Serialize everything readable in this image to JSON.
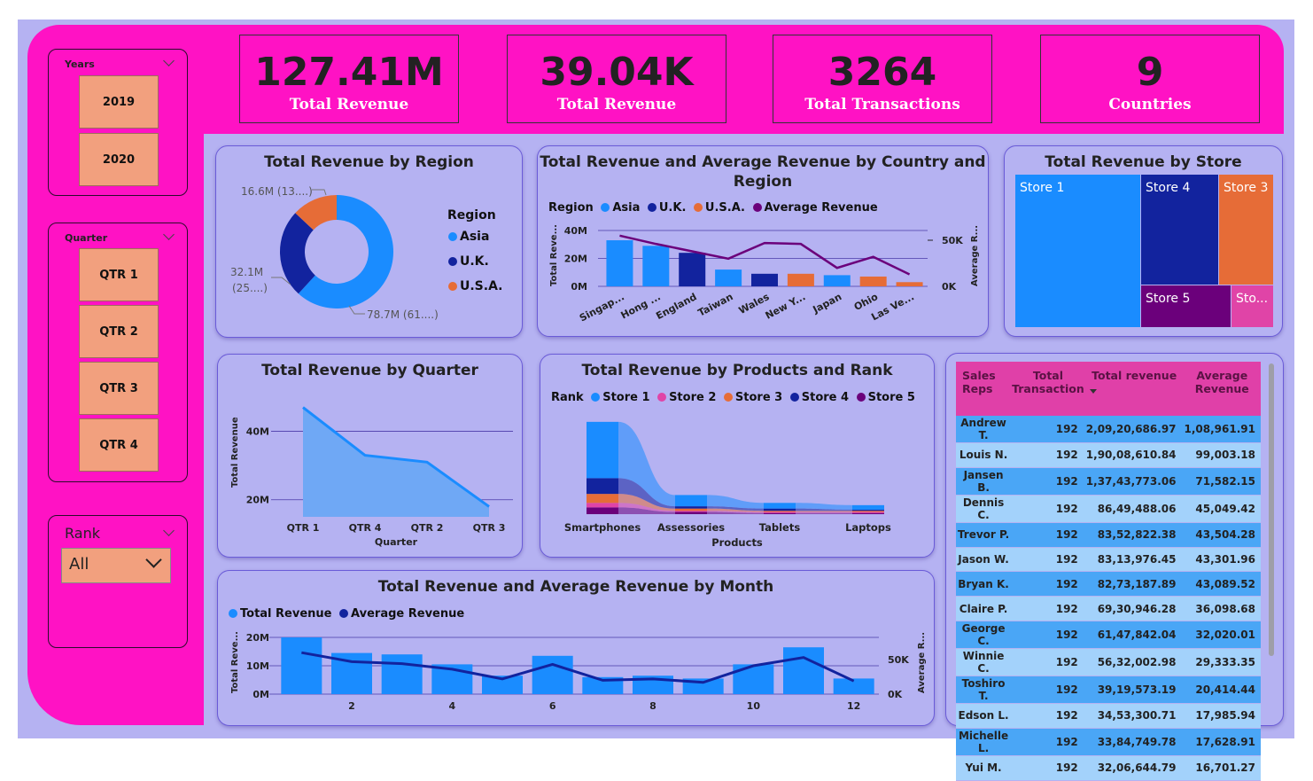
{
  "slicers": {
    "years": {
      "title": "Years",
      "items": [
        "2019",
        "2020"
      ]
    },
    "quarter": {
      "title": "Quarter",
      "items": [
        "QTR 1",
        "QTR 2",
        "QTR 3",
        "QTR 4"
      ]
    },
    "rank": {
      "title": "Rank",
      "selected": "All"
    }
  },
  "kpis": [
    {
      "value": "127.41M",
      "label": "Total Revenue"
    },
    {
      "value": "39.04K",
      "label": "Total Revenue"
    },
    {
      "value": "3264",
      "label": "Total Transactions"
    },
    {
      "value": "9",
      "label": "Countries"
    }
  ],
  "colors": {
    "asia": "#1a8cff",
    "uk": "#12239e",
    "usa": "#e66c37",
    "average": "#6b007b",
    "store2": "#e044a7",
    "store5": "#744ec2"
  },
  "region_chart": {
    "title": "Total Revenue by Region",
    "legend_title": "Region",
    "legend": [
      "Asia",
      "U.K.",
      "U.S.A."
    ],
    "labels": {
      "usa": "16.6M (13....)",
      "uk_line1": "32.1M",
      "uk_line2": "(25....)",
      "asia": "78.7M (61....)"
    }
  },
  "country_chart": {
    "title_line1": "Total Revenue and Average Revenue by Country and",
    "title_line2": "Region",
    "legend_label": "Region",
    "legend": [
      "Asia",
      "U.K.",
      "U.S.A.",
      "Average Revenue"
    ],
    "y_ticks": [
      "40M",
      "20M",
      "0M"
    ],
    "y2_ticks": [
      "50K",
      "0K"
    ],
    "y_axis": "Total Reve...",
    "y2_axis": "Average R...",
    "countries": [
      "Singap...",
      "Hong ...",
      "England",
      "Taiwan",
      "Wales",
      "New Y...",
      "Japan",
      "Ohio",
      "Las Ve..."
    ]
  },
  "store_chart": {
    "title": "Total Revenue by Store",
    "stores": [
      "Store 1",
      "Store 4",
      "Store 3",
      "Store 5",
      "Sto..."
    ]
  },
  "quarter_chart": {
    "title": "Total Revenue by Quarter",
    "y_axis": "Total Revenue",
    "x_axis": "Quarter",
    "y_ticks": [
      "40M",
      "20M"
    ],
    "categories": [
      "QTR 1",
      "QTR 4",
      "QTR 2",
      "QTR 3"
    ]
  },
  "products_chart": {
    "title": "Total Revenue by Products and Rank",
    "legend_label": "Rank",
    "legend": [
      "Store 1",
      "Store 2",
      "Store 3",
      "Store 4",
      "Store 5"
    ],
    "categories": [
      "Smartphones",
      "Assessories",
      "Tablets",
      "Laptops"
    ],
    "x_axis": "Products"
  },
  "month_chart": {
    "title": "Total Revenue and Average Revenue by Month",
    "legend": [
      "Total Revenue",
      "Average Revenue"
    ],
    "y_ticks": [
      "20M",
      "10M",
      "0M"
    ],
    "y2_ticks": [
      "50K",
      "0K"
    ],
    "y_axis": "Total Reve...",
    "y2_axis": "Average R...",
    "x_ticks": [
      "2",
      "4",
      "6",
      "8",
      "10",
      "12"
    ]
  },
  "sales_table": {
    "headers": [
      "Sales Reps",
      "Total Transaction",
      "Total revenue",
      "Average Revenue"
    ],
    "rows": [
      [
        "Andrew T.",
        "192",
        "2,09,20,686.97",
        "1,08,961.91"
      ],
      [
        "Louis N.",
        "192",
        "1,90,08,610.84",
        "99,003.18"
      ],
      [
        "Jansen B.",
        "192",
        "1,37,43,773.06",
        "71,582.15"
      ],
      [
        "Dennis C.",
        "192",
        "86,49,488.06",
        "45,049.42"
      ],
      [
        "Trevor P.",
        "192",
        "83,52,822.38",
        "43,504.28"
      ],
      [
        "Jason W.",
        "192",
        "83,13,976.45",
        "43,301.96"
      ],
      [
        "Bryan K.",
        "192",
        "82,73,187.89",
        "43,089.52"
      ],
      [
        "Claire P.",
        "192",
        "69,30,946.28",
        "36,098.68"
      ],
      [
        "George C.",
        "192",
        "61,47,842.04",
        "32,020.01"
      ],
      [
        "Winnie C.",
        "192",
        "56,32,002.98",
        "29,333.35"
      ],
      [
        "Toshiro T.",
        "192",
        "39,19,573.19",
        "20,414.44"
      ],
      [
        "Edson L.",
        "192",
        "34,53,300.71",
        "17,985.94"
      ],
      [
        "Michelle L.",
        "192",
        "33,84,749.78",
        "17,628.91"
      ],
      [
        "Yui M.",
        "192",
        "32,06,644.79",
        "16,701.27"
      ]
    ]
  },
  "chart_data": [
    {
      "type": "pie",
      "title": "Total Revenue by Region",
      "categories": [
        "Asia",
        "U.K.",
        "U.S.A."
      ],
      "values": [
        78.7,
        32.1,
        16.6
      ],
      "units": "M"
    },
    {
      "type": "bar",
      "title": "Total Revenue and Average Revenue by Country and Region",
      "categories": [
        "Singap...",
        "Hong ...",
        "England",
        "Taiwan",
        "Wales",
        "New Y...",
        "Japan",
        "Ohio",
        "Las Ve..."
      ],
      "series": [
        {
          "name": "Total Revenue",
          "values": [
            33,
            29,
            24,
            12,
            9,
            9,
            8,
            7,
            3
          ],
          "regions": [
            "Asia",
            "Asia",
            "U.K.",
            "Asia",
            "U.K.",
            "U.S.A.",
            "Asia",
            "U.S.A.",
            "U.S.A."
          ]
        },
        {
          "name": "Average Revenue",
          "values": [
            55,
            46,
            38,
            30,
            47,
            46,
            20,
            32,
            13
          ]
        }
      ],
      "ylim": [
        0,
        45
      ],
      "y2lim": [
        0,
        70
      ]
    },
    {
      "type": "area",
      "title": "Total Revenue by Quarter",
      "categories": [
        "QTR 1",
        "QTR 4",
        "QTR 2",
        "QTR 3"
      ],
      "values": [
        47,
        33,
        31,
        18
      ],
      "ylim": [
        10,
        50
      ]
    },
    {
      "type": "area",
      "title": "Total Revenue by Products and Rank",
      "categories": [
        "Smartphones",
        "Assessories",
        "Tablets",
        "Laptops"
      ],
      "series": [
        {
          "name": "Store 1",
          "values": [
            50,
            10,
            5,
            4
          ]
        },
        {
          "name": "Store 4",
          "values": [
            14,
            2,
            2,
            1
          ]
        },
        {
          "name": "Store 3",
          "values": [
            8,
            2,
            1,
            1
          ]
        },
        {
          "name": "Store 5",
          "values": [
            6,
            2,
            1,
            1
          ]
        },
        {
          "name": "Store 2",
          "values": [
            4,
            1,
            1,
            1
          ]
        }
      ]
    },
    {
      "type": "bar",
      "title": "Total Revenue and Average Revenue by Month",
      "x": [
        1,
        2,
        3,
        4,
        5,
        6,
        7,
        8,
        9,
        10,
        11,
        12
      ],
      "series": [
        {
          "name": "Total Revenue",
          "values": [
            20,
            14.5,
            14,
            10.5,
            6.5,
            13.5,
            6,
            6.5,
            5.5,
            10.5,
            16.5,
            5.5
          ]
        },
        {
          "name": "Average Revenue",
          "values": [
            60,
            47,
            44,
            36,
            22,
            43,
            20,
            22,
            17,
            41,
            53,
            19
          ]
        }
      ],
      "ylim": [
        0,
        20
      ],
      "y2lim": [
        0,
        75
      ]
    }
  ]
}
